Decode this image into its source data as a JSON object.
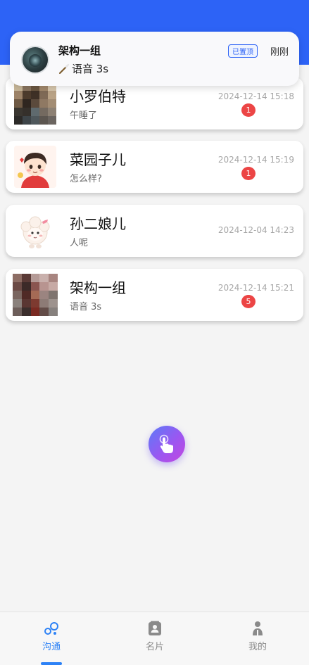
{
  "notification": {
    "title": "架构一组",
    "message": "语音 3s",
    "pinned_label": "已置顶",
    "time": "刚刚",
    "message_icon": "wand-icon"
  },
  "conversations": [
    {
      "name": "小罗伯特",
      "last_message": "午睡了",
      "time": "2024-12-14 15:18",
      "unread": "1",
      "avatar": "pixelated-photo"
    },
    {
      "name": "菜园子儿",
      "last_message": "怎么样?",
      "time": "2024-12-14 15:19",
      "unread": "1",
      "avatar": "cartoon-boy"
    },
    {
      "name": "孙二娘儿",
      "last_message": "人呢",
      "time": "2024-12-04 14:23",
      "unread": "",
      "avatar": "cartoon-sheep"
    },
    {
      "name": "架构一组",
      "last_message": "语音 3s",
      "time": "2024-12-14 15:21",
      "unread": "5",
      "avatar": "pixelated-photo"
    }
  ],
  "fab": {
    "icon": "tap-hand-icon"
  },
  "tabbar": {
    "tabs": [
      {
        "label": "沟通",
        "icon": "bubbles-icon",
        "active": true
      },
      {
        "label": "名片",
        "icon": "contact-card-icon",
        "active": false
      },
      {
        "label": "我的",
        "icon": "person-icon",
        "active": false
      }
    ]
  },
  "colors": {
    "accent": "#2d63f6",
    "tab_active": "#2d82f6",
    "unread_badge": "#ec4545",
    "background": "#f4f4f4",
    "fab_gradient": [
      "#5b7cf7",
      "#9a57f1",
      "#c447e0"
    ]
  }
}
